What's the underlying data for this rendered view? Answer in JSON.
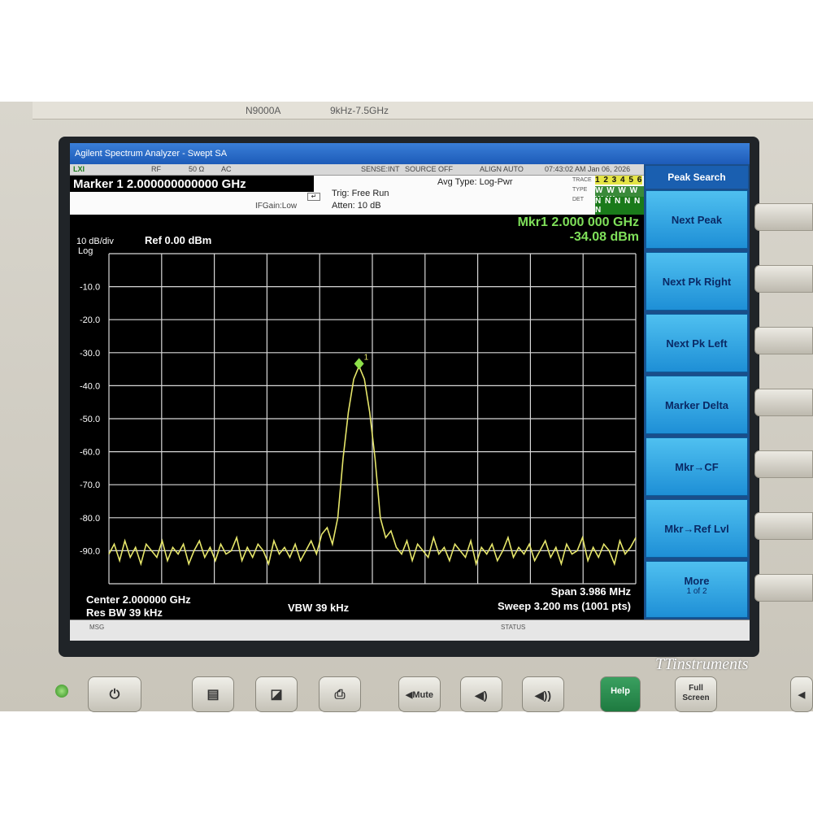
{
  "instrument": {
    "model": "N9000A",
    "freq_range": "9kHz-7.5GHz"
  },
  "window": {
    "title": "Agilent Spectrum Analyzer - Swept SA"
  },
  "status_bar": {
    "mode": "LXI",
    "rf": "RF",
    "impedance": "50 Ω",
    "coupling": "AC",
    "sense": "SENSE:INT",
    "source": "SOURCE OFF",
    "align": "ALIGN AUTO",
    "datetime": "07:43:02 AM Jan 06, 2026"
  },
  "info_panel": {
    "marker_title": "Marker 1  2.000000000000 GHz",
    "ifgain": "IFGain:Low",
    "trig": "Trig: Free Run",
    "atten": "Atten: 10 dB",
    "avg_type": "Avg Type: Log-Pwr",
    "trace_label": "TRACE",
    "type_label": "TYPE",
    "det_label": "DET",
    "trace_numbers": "1 2 3 4 5 6",
    "type_values": "W W W W W W",
    "det_values": "N N N N N N"
  },
  "display": {
    "scale": "10 dB/div",
    "scale_type": "Log",
    "ref_level": "Ref 0.00 dBm",
    "marker_readout_freq": "Mkr1 2.000 000 GHz",
    "marker_readout_level": "-34.08 dBm",
    "center": "Center 2.000000 GHz",
    "res_bw": "Res BW 39 kHz",
    "vbw": "VBW 39 kHz",
    "span": "Span 3.986 MHz",
    "sweep": "Sweep  3.200 ms (1001 pts)",
    "marker_number": "1"
  },
  "softkeys": {
    "title": "Peak Search",
    "items": [
      {
        "label": "Next Peak"
      },
      {
        "label": "Next Pk Right"
      },
      {
        "label": "Next Pk Left"
      },
      {
        "label": "Marker Delta"
      },
      {
        "label": "Mkr→CF"
      },
      {
        "label": "Mkr→Ref Lvl"
      },
      {
        "label": "More",
        "sub": "1 of 2"
      }
    ]
  },
  "message_bar": {
    "msg": "MSG",
    "status": "STATUS"
  },
  "hardware_buttons": {
    "mute": "Mute",
    "help": "Help",
    "full_screen_1": "Full",
    "full_screen_2": "Screen"
  },
  "watermark": "TTinstruments",
  "colors": {
    "trace": "#e6e66a",
    "marker": "#8ee04a",
    "readout": "#7fe05a",
    "grid": "#d8d8d8",
    "softkey": "#2ea0e6"
  },
  "chart_data": {
    "type": "line",
    "ylabel": "",
    "xlabel": "",
    "y_ticks": [
      "-10.0",
      "-20.0",
      "-30.0",
      "-40.0",
      "-50.0",
      "-60.0",
      "-70.0",
      "-80.0",
      "-90.0"
    ],
    "ylim": [
      -100,
      0
    ],
    "x_center_ghz": 2.0,
    "span_mhz": 3.986,
    "x_divisions": 10,
    "y_divisions": 10,
    "peak": {
      "x_mhz_offset": 0.0,
      "level_dbm": -34.08
    },
    "noise_floor_dbm": -90,
    "series": [
      {
        "values": [
          -91,
          -88,
          -93,
          -87,
          -92,
          -89,
          -94,
          -88,
          -90,
          -92,
          -87,
          -93,
          -89,
          -91,
          -88,
          -94,
          -90,
          -87,
          -92,
          -89,
          -93,
          -88,
          -91,
          -90,
          -86,
          -93,
          -89,
          -92,
          -88,
          -90,
          -94,
          -87,
          -91,
          -89,
          -92,
          -88,
          -93,
          -90,
          -87,
          -91,
          -85,
          -83,
          -88,
          -80,
          -62,
          -48,
          -38,
          -34.08,
          -38,
          -48,
          -62,
          -80,
          -86,
          -84,
          -89,
          -91,
          -87,
          -93,
          -88,
          -90,
          -92,
          -86,
          -91,
          -89,
          -93,
          -88,
          -90,
          -92,
          -87,
          -94,
          -89,
          -91,
          -88,
          -93,
          -90,
          -86,
          -92,
          -89,
          -91,
          -88,
          -93,
          -90,
          -87,
          -92,
          -89,
          -94,
          -88,
          -91,
          -90,
          -86,
          -93,
          -89,
          -92,
          -88,
          -90,
          -94,
          -87,
          -91,
          -89,
          -86
        ]
      }
    ]
  }
}
